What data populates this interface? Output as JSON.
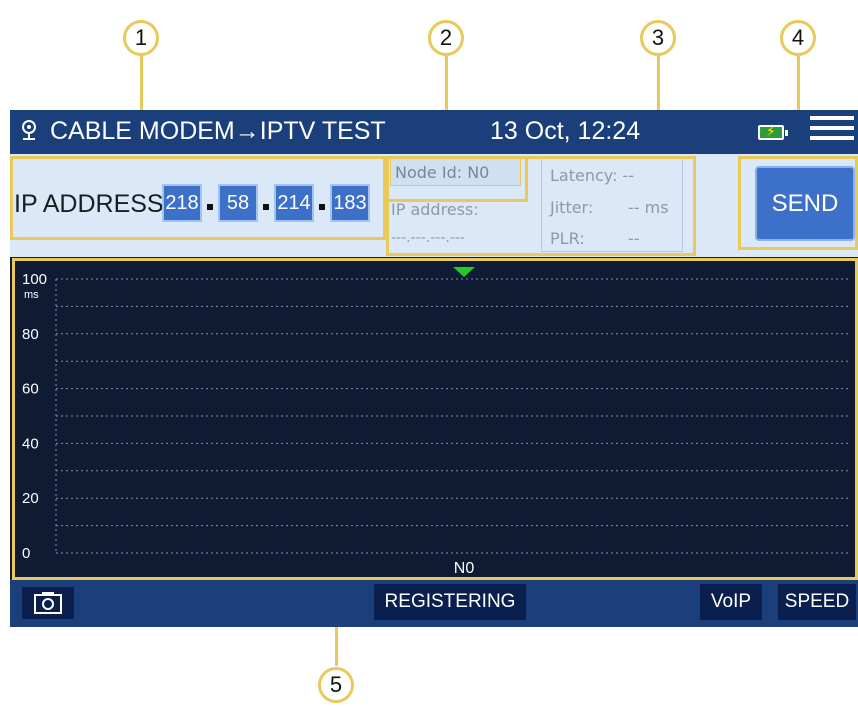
{
  "callouts": [
    "1",
    "2",
    "3",
    "4",
    "5"
  ],
  "header": {
    "title": "CABLE MODEM→IPTV TEST",
    "datetime": "13 Oct, 12:24"
  },
  "ip": {
    "label": "IP ADDRESS:",
    "octets": [
      "218",
      "58",
      "214",
      "183"
    ]
  },
  "node": {
    "node_id": "Node Id:  N0",
    "ip_label": "IP address:",
    "ip_value": "---.---.---.---"
  },
  "stats": {
    "latency": "Latency: --",
    "jitter_label": "Jitter:",
    "jitter_value": "-- ms",
    "plr_label": "PLR:",
    "plr_value": "--"
  },
  "actions": {
    "send": "SEND"
  },
  "footer": {
    "status": "REGISTERING",
    "voip": "VoIP",
    "speed": "SPEED"
  },
  "chart_data": {
    "type": "line",
    "ylabel": "ms",
    "ylim": [
      0,
      100
    ],
    "yticks": [
      0,
      20,
      40,
      60,
      80,
      100
    ],
    "categories": [
      "N0"
    ],
    "series": [],
    "grid": true,
    "marker": "green-triangle"
  },
  "colors": {
    "accent": "#3d70c9",
    "header": "#1a3f7a",
    "highlight": "#e8c95a",
    "marker": "#22cc22"
  },
  "icons": {
    "logo": "person-location-icon",
    "battery": "battery-charging-icon",
    "menu": "hamburger-menu-icon",
    "camera": "camera-icon"
  }
}
